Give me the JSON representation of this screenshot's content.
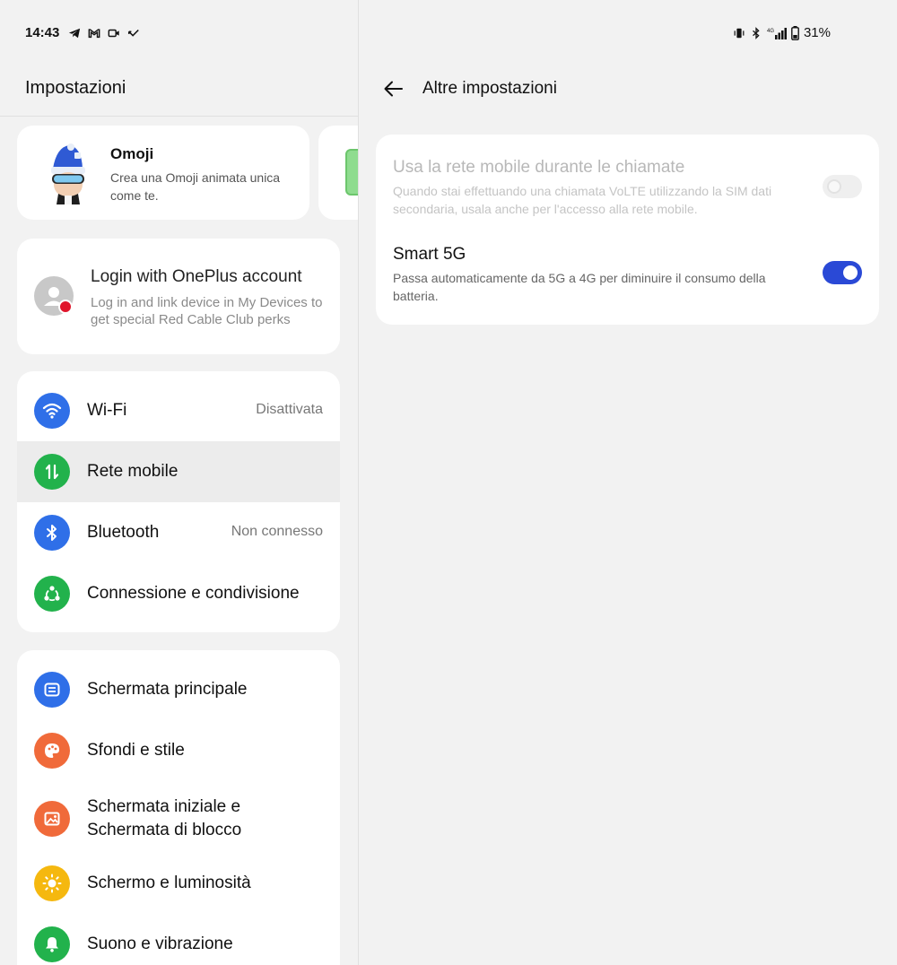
{
  "status_bar": {
    "time": "14:43",
    "battery": "31%",
    "left_icons": [
      "telegram-icon",
      "gmail-icon",
      "recorder-icon",
      "missed-call-icon"
    ],
    "right_icons": [
      "vibrate-icon",
      "bluetooth-icon",
      "signal-4g-icon",
      "battery-icon"
    ]
  },
  "left": {
    "title": "Impostazioni",
    "omoji": {
      "title": "Omoji",
      "subtitle": "Crea una Omoji animata unica come te."
    },
    "login": {
      "title": "Login with OnePlus account",
      "subtitle": "Log in and link device in My Devices to get special Red Cable Club perks"
    },
    "network_items": [
      {
        "label": "Wi-Fi",
        "value": "Disattivata",
        "icon": "wifi-icon",
        "color": "#2f6fe8"
      },
      {
        "label": "Rete mobile",
        "value": "",
        "icon": "mobile-data-icon",
        "color": "#22b24c"
      },
      {
        "label": "Bluetooth",
        "value": "Non connesso",
        "icon": "bluetooth-icon",
        "color": "#2f6fe8"
      },
      {
        "label": "Connessione e condivisione",
        "value": "",
        "icon": "share-icon",
        "color": "#22b24c"
      }
    ],
    "display_items": [
      {
        "label": "Schermata principale",
        "icon": "home-screen-icon",
        "color": "#2f6fe8"
      },
      {
        "label": "Sfondi e stile",
        "icon": "palette-icon",
        "color": "#f06a3a"
      },
      {
        "label": "Schermata iniziale e Schermata di blocco",
        "icon": "image-icon",
        "color": "#f06a3a"
      },
      {
        "label": "Schermo e luminosità",
        "icon": "brightness-icon",
        "color": "#f5b80f"
      },
      {
        "label": "Suono e vibrazione",
        "icon": "bell-icon",
        "color": "#22b24c"
      }
    ]
  },
  "right": {
    "title": "Altre impostazioni",
    "options": [
      {
        "title": "Usa la rete mobile durante le chiamate",
        "description": "Quando stai effettuando una chiamata VoLTE utilizzando la SIM dati secondaria, usala anche per l'accesso alla rete mobile.",
        "enabled": false,
        "checked": false
      },
      {
        "title": "Smart 5G",
        "description": "Passa automaticamente da 5G a 4G per diminuire il consumo della batteria.",
        "enabled": true,
        "checked": true
      }
    ]
  },
  "colors": {
    "accent": "#2a49d6",
    "selected_row": "#ececec"
  }
}
